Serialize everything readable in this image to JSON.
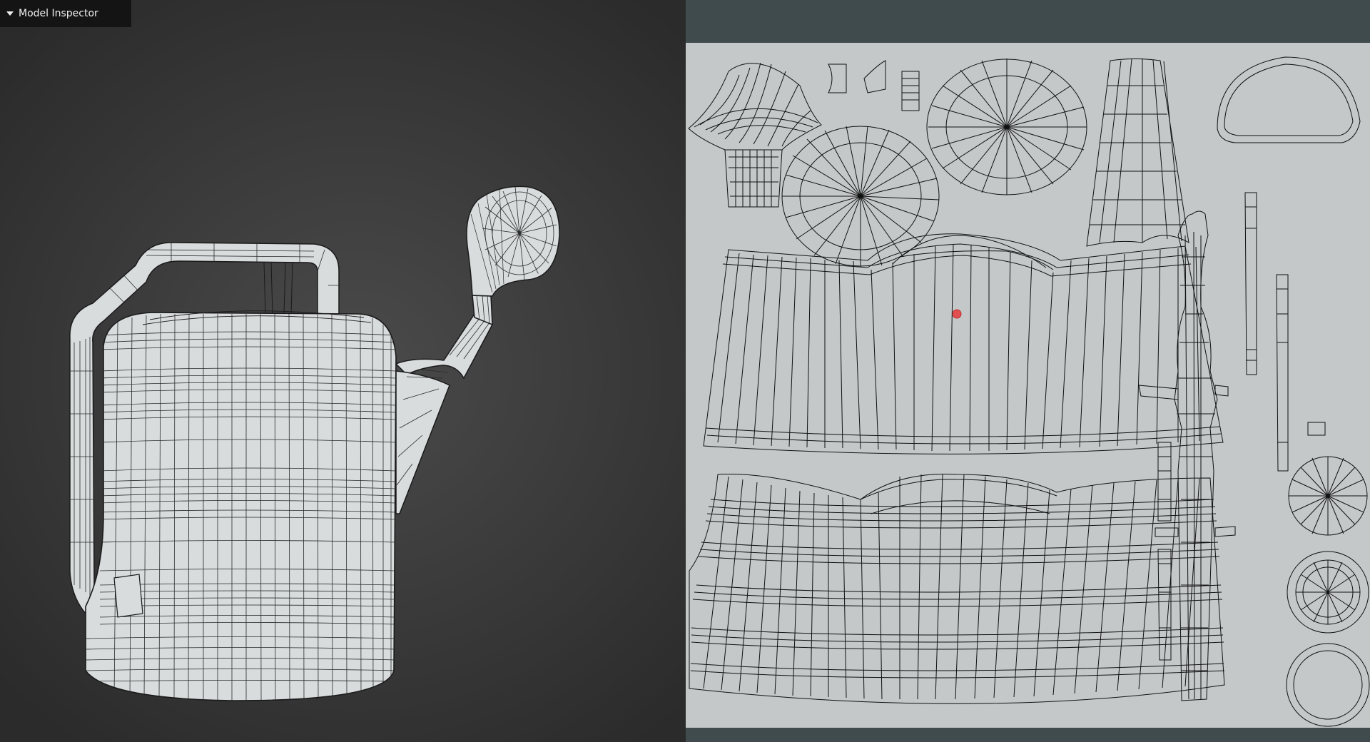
{
  "inspector": {
    "title": "Model Inspector",
    "collapse_icon": "triangle-down-icon"
  },
  "viewport": {
    "object": "watering-can-wireframe",
    "background_color": "#3f3f3f",
    "mesh_fill": "#d8dcdd",
    "wire_color": "#1a1a1a"
  },
  "uv_editor": {
    "background_color": "#3f4b4d",
    "canvas_color": "#c4c8c9",
    "cursor_color": "#e05050"
  }
}
